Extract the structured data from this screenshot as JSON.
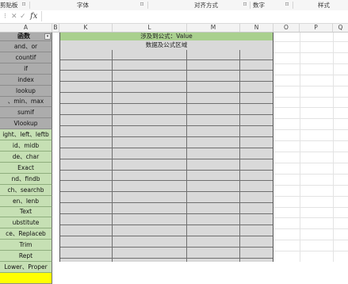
{
  "ribbon": {
    "groups": [
      "剪贴板",
      "字体",
      "对齐方式",
      "数字",
      "样式"
    ],
    "launcher_glyph": "⊡"
  },
  "formula_bar": {
    "name_box_glyph": "⁝",
    "cancel_glyph": "✕",
    "enter_glyph": "✓",
    "fx_label": "fx",
    "value": ""
  },
  "columns": [
    "A",
    "B",
    "K",
    "L",
    "M",
    "N",
    "O",
    "P",
    "Q"
  ],
  "sheet": {
    "a_header": "函数",
    "a_header_dropdown": "▾",
    "a_cells": [
      {
        "text": "and、or",
        "style": "gray"
      },
      {
        "text": "countif",
        "style": "gray"
      },
      {
        "text": "if",
        "style": "gray"
      },
      {
        "text": "index",
        "style": "gray"
      },
      {
        "text": "lookup",
        "style": "gray"
      },
      {
        "text": "、min、max",
        "style": "gray"
      },
      {
        "text": "sumif",
        "style": "gray"
      },
      {
        "text": "Vlookup",
        "style": "gray"
      },
      {
        "text": "ight、left、leftb",
        "style": "green"
      },
      {
        "text": "id、midb",
        "style": "green"
      },
      {
        "text": "de、char",
        "style": "green"
      },
      {
        "text": "Exact",
        "style": "green"
      },
      {
        "text": "nd、findb",
        "style": "green"
      },
      {
        "text": "ch、searchb",
        "style": "green"
      },
      {
        "text": "en、lenb",
        "style": "green"
      },
      {
        "text": "Text",
        "style": "green"
      },
      {
        "text": "ubstitute",
        "style": "green"
      },
      {
        "text": "ce、Replaceb",
        "style": "green"
      },
      {
        "text": "Trim",
        "style": "green"
      },
      {
        "text": "Rept",
        "style": "green"
      },
      {
        "text": "Lower、Proper",
        "style": "green"
      },
      {
        "text": "",
        "style": "yellow"
      }
    ],
    "banner": "涉及到公式：Value",
    "data_title": "数据及公式区域"
  }
}
